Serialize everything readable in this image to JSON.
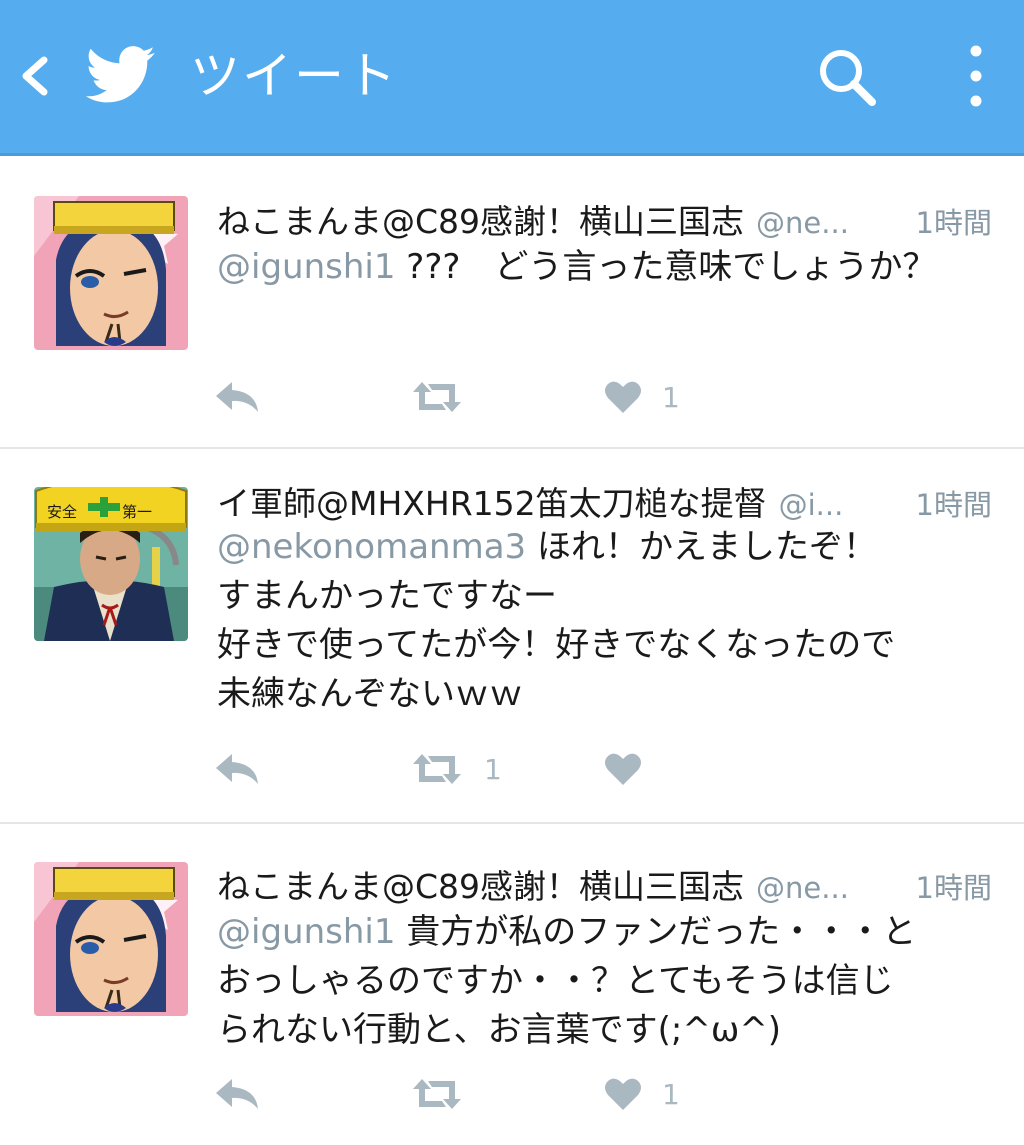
{
  "header": {
    "back_icon": "chevron-left-icon",
    "logo_icon": "twitter-bird-icon",
    "title": "ツイート",
    "search_icon": "search-icon",
    "more_icon": "overflow-menu-icon"
  },
  "colors": {
    "header_bg": "#55acee",
    "text_primary": "#1a1a1a",
    "text_secondary": "#8899a6",
    "action_icon": "#aab8c2"
  },
  "tweets": [
    {
      "author": "ねこまんま@C89感謝！横山三国志",
      "handle": "@ne...",
      "time": "1時間",
      "mention": "@igunshi1",
      "lines": [
        "???　どう言った意味でしょうか？"
      ],
      "reply_count": "",
      "retweet_count": "",
      "like_count": "1"
    },
    {
      "author": "イ軍師@MHXHR152笛太刀槌な提督",
      "handle": "@i...",
      "time": "1時間",
      "mention": "@nekonomanma3",
      "lines": [
        "ほれ！かえましたぞ！",
        "すまんかったですなー",
        "好きで使ってたが今！好きでなくなったので",
        "未練なんぞないｗｗ"
      ],
      "reply_count": "",
      "retweet_count": "1",
      "like_count": ""
    },
    {
      "author": "ねこまんま@C89感謝！横山三国志",
      "handle": "@ne...",
      "time": "1時間",
      "mention": "@igunshi1",
      "lines": [
        "貴方が私のファンだった・・・と",
        "おっしゃるのですか・・？とてもそうは信じ",
        "られない行動と、お言葉です(;^ω^)"
      ],
      "reply_count": "",
      "retweet_count": "",
      "like_count": "1"
    }
  ]
}
